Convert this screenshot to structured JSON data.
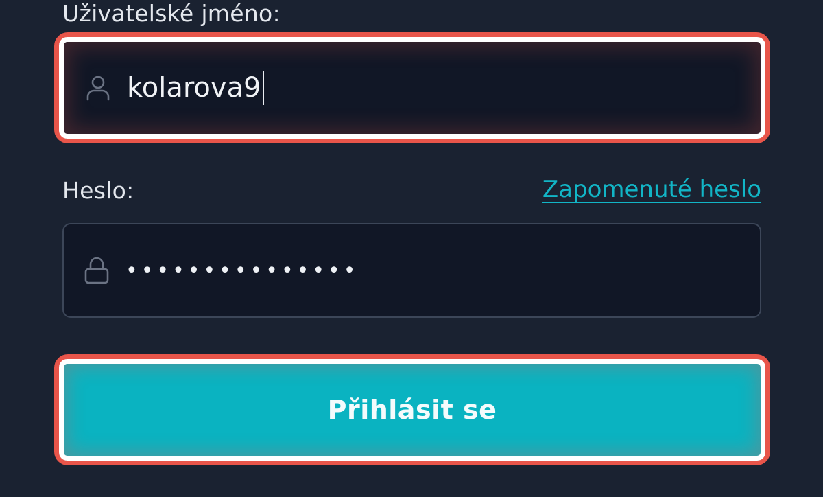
{
  "login_form": {
    "username_label": "Uživatelské jméno:",
    "username_value": "kolarova9",
    "password_label": "Heslo:",
    "forgot_password_link": "Zapomenuté heslo",
    "password_masked": "•••••••••••••••",
    "submit_label": "Přihlásit se"
  },
  "icons": {
    "username": "user-icon",
    "password": "lock-icon"
  },
  "colors": {
    "background": "#1a2231",
    "input_background": "#111726",
    "accent": "#0ab3c1",
    "link": "#12b5c6",
    "highlight_outer": "#e8554a",
    "highlight_inner": "#ffffff"
  }
}
